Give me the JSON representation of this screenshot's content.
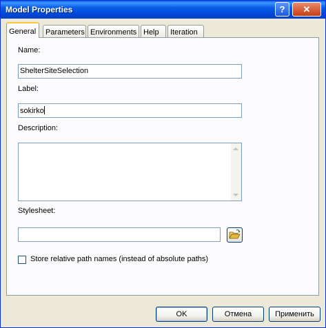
{
  "window": {
    "title": "Model Properties",
    "help_glyph": "?",
    "close_glyph": "✕"
  },
  "tabs": [
    {
      "label": "General",
      "active": true
    },
    {
      "label": "Parameters",
      "active": false
    },
    {
      "label": "Environments",
      "active": false
    },
    {
      "label": "Help",
      "active": false
    },
    {
      "label": "Iteration",
      "active": false
    }
  ],
  "form": {
    "name_label": "Name:",
    "name_value": "ShelterSiteSelection",
    "label_label": "Label:",
    "label_value": "sokirko",
    "description_label": "Description:",
    "description_value": "",
    "stylesheet_label": "Stylesheet:",
    "stylesheet_value": "",
    "checkbox_label": "Store relative path names (instead of absolute paths)",
    "checkbox_checked": false
  },
  "buttons": {
    "ok": "OK",
    "cancel": "Отмена",
    "apply": "Применить"
  },
  "colors": {
    "titlebar": "#0a5ee6",
    "dialog_bg": "#ece9d8",
    "tab_accent": "#ffc83c",
    "folder_icon": "#e8b83a"
  },
  "icons": {
    "browse": "folder-open-icon",
    "help": "help-icon",
    "close": "close-icon"
  }
}
